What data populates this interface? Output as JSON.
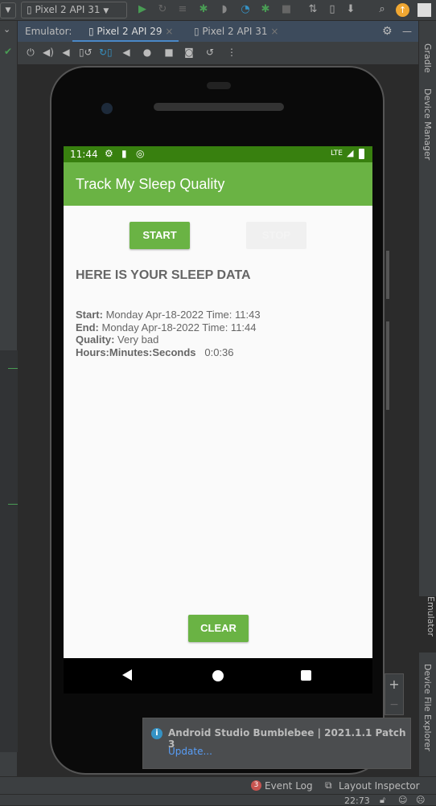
{
  "toolbar": {
    "device_selector": "Pixel 2 API 31",
    "icons": [
      "run-icon",
      "apply-changes-icon",
      "apply-code-icon",
      "debug-icon",
      "attach-debugger-icon",
      "profiler-icon",
      "attach-process-icon",
      "stop-icon",
      "gradle-sync-icon",
      "avd-manager-icon",
      "sdk-manager-icon",
      "search-icon",
      "update-icon",
      "avatar-icon"
    ]
  },
  "emulator_panel": {
    "label": "Emulator:",
    "tabs": [
      {
        "label": "Pixel 2 API 29",
        "active": true
      },
      {
        "label": "Pixel 2 API 31",
        "active": false
      }
    ]
  },
  "emulator_toolbar": {
    "icons": [
      "power-icon",
      "volume-up-icon",
      "volume-down-icon",
      "rotate-left-icon",
      "rotate-right-icon",
      "back-icon",
      "home-icon",
      "overview-icon",
      "screenshot-icon",
      "snapshot-icon",
      "more-icon"
    ]
  },
  "right_tabs": {
    "gradle": "Gradle",
    "device_manager": "Device Manager",
    "emulator": "Emulator",
    "device_file_explorer": "Device File Explorer"
  },
  "zoom": {
    "in": "+",
    "out": "−"
  },
  "phone": {
    "status_bar": {
      "time": "11:44",
      "network": "LTE"
    },
    "app_title": "Track My Sleep Quality",
    "start_button": "START",
    "stop_button": "STOP",
    "heading": "HERE IS YOUR SLEEP DATA",
    "sleep_data": {
      "start_label": "Start:",
      "start_value": "Monday Apr-18-2022 Time: 11:43",
      "end_label": "End:",
      "end_value": "Monday Apr-18-2022 Time: 11:44",
      "quality_label": "Quality:",
      "quality_value": "Very bad",
      "duration_label": "Hours:Minutes:Seconds",
      "duration_value": "0:0:36"
    },
    "clear_button": "CLEAR",
    "colors": {
      "primary": "#6ab344",
      "primary_dark": "#38800f"
    }
  },
  "notification": {
    "title": "Android Studio Bumblebee | 2021.1.1 Patch 3",
    "link": "Update..."
  },
  "bottom_bar": {
    "event_log_count": "3",
    "event_log": "Event Log",
    "layout_inspector": "Layout Inspector"
  },
  "status_line": {
    "position": "22:73"
  }
}
